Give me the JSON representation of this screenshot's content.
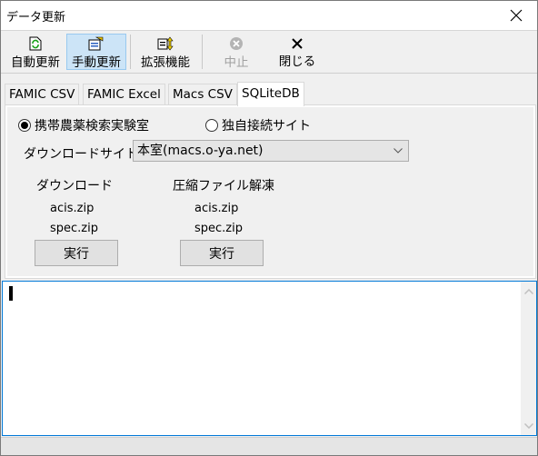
{
  "window": {
    "title": "データ更新",
    "close_icon": "close-icon"
  },
  "toolbar": {
    "buttons": [
      {
        "label": "自動更新",
        "icon": "auto-update-icon",
        "active": false,
        "enabled": true
      },
      {
        "label": "手動更新",
        "icon": "manual-update-icon",
        "active": true,
        "enabled": true
      },
      {
        "label": "拡張機能",
        "icon": "extension-icon",
        "active": false,
        "enabled": true
      },
      {
        "label": "中止",
        "icon": "stop-icon",
        "active": false,
        "enabled": false
      },
      {
        "label": "閉じる",
        "icon": "close-icon",
        "active": false,
        "enabled": true
      }
    ]
  },
  "tabs": [
    {
      "label": "FAMIC CSV",
      "selected": false
    },
    {
      "label": "FAMIC Excel",
      "selected": false
    },
    {
      "label": "Macs CSV",
      "selected": false
    },
    {
      "label": "SQLiteDB",
      "selected": true
    }
  ],
  "panel": {
    "radios": [
      {
        "label": "携帯農薬検索実験室",
        "checked": true
      },
      {
        "label": "独自接続サイト",
        "checked": false
      }
    ],
    "download_site_label": "ダウンロードサイト",
    "download_site_value": "本室(macs.o-ya.net)",
    "download": {
      "heading": "ダウンロード",
      "files": [
        "acis.zip",
        "spec.zip"
      ],
      "button_label": "実行"
    },
    "extract": {
      "heading": "圧縮ファイル解凍",
      "files": [
        "acis.zip",
        "spec.zip"
      ],
      "button_label": "実行"
    }
  },
  "log": {
    "text": ""
  },
  "colors": {
    "accent": "#0078d7",
    "active_button_bg": "#cce4f7",
    "active_button_border": "#99c9ef",
    "disabled_text": "#a0a0a0"
  }
}
